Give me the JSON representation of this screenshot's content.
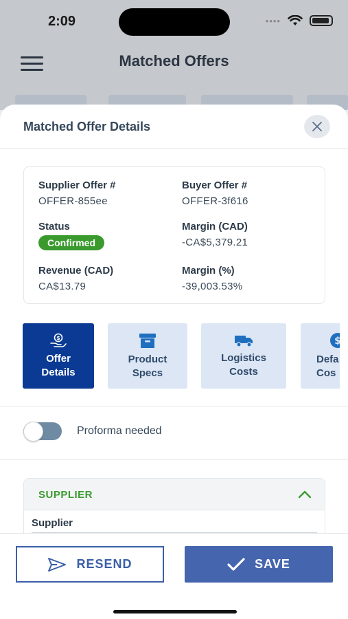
{
  "status_bar": {
    "time": "2:09"
  },
  "app": {
    "title": "Matched Offers",
    "menu_icon": "hamburger-icon"
  },
  "sheet": {
    "title": "Matched Offer Details",
    "close_icon": "close-icon",
    "summary": {
      "supplier_offer_label": "Supplier Offer #",
      "supplier_offer_value": "OFFER-855ee",
      "buyer_offer_label": "Buyer Offer #",
      "buyer_offer_value": "OFFER-3f616",
      "status_label": "Status",
      "status_value": "Confirmed",
      "margin_cad_label": "Margin (CAD)",
      "margin_cad_value": "-CA$5,379.21",
      "revenue_cad_label": "Revenue (CAD)",
      "revenue_cad_value": "CA$13.79",
      "margin_pct_label": "Margin (%)",
      "margin_pct_value": "-39,003.53%"
    },
    "tabs": [
      {
        "label": "Offer\nDetails",
        "icon": "hand-coin-icon",
        "active": true
      },
      {
        "label": "Product\nSpecs",
        "icon": "archive-box-icon",
        "active": false
      },
      {
        "label": "Logistics\nCosts",
        "icon": "truck-icon",
        "active": false
      },
      {
        "label": "Defa\nCos",
        "icon": "dollar-circle-icon",
        "active": false
      }
    ],
    "proforma_label": "Proforma needed",
    "proforma_on": false,
    "supplier_section": {
      "title": "SUPPLIER",
      "field_label": "Supplier"
    }
  },
  "footer": {
    "resend_label": "RESEND",
    "save_label": "SAVE"
  },
  "colors": {
    "primary": "#0a3a93",
    "button": "#4565ae",
    "success": "#3a9a2e",
    "tab_bg": "#dce6f4"
  }
}
